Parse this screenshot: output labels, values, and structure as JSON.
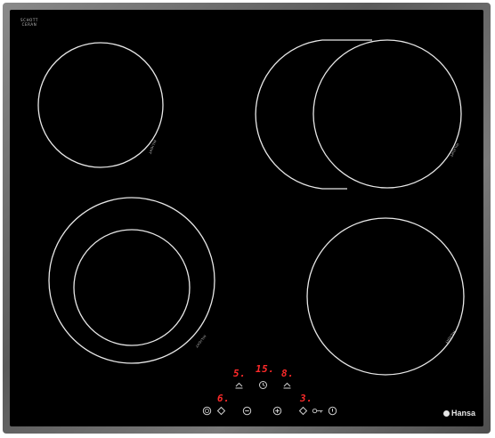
{
  "cooktop": {
    "top_label_line1": "SCHOTT",
    "top_label_line2": "CERAN",
    "brand": "Hansa",
    "zone_marking": "HILIGHT"
  },
  "controls": {
    "zone_rear_left_level": "5.",
    "timer_value": "15.",
    "zone_rear_right_level": "8.",
    "zone_front_left_level": "6.",
    "zone_front_right_level": "3."
  },
  "colors": {
    "glass": "#000000",
    "frame": "#6e6e6e",
    "ring": "#e8e8e8",
    "display": "#ff2a2a"
  },
  "icons": {
    "power": "power-icon",
    "lock": "key-lock-icon",
    "minus": "minus-icon",
    "plus": "plus-icon",
    "timer": "clock-icon",
    "zone_selector": "zone-selector-icon"
  }
}
